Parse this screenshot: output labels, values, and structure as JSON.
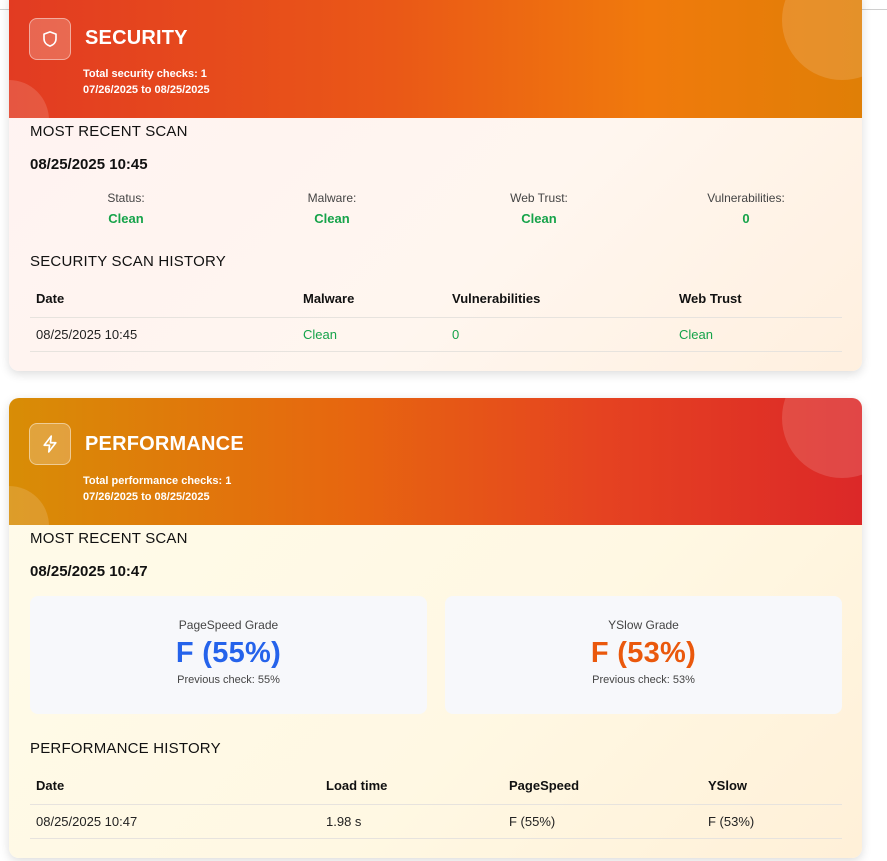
{
  "security": {
    "title": "SECURITY",
    "checks_text": "Total security checks: 1",
    "date_range": "07/26/2025 to 08/25/2025",
    "recent_heading": "MOST RECENT SCAN",
    "recent_time": "08/25/2025 10:45",
    "stats": [
      {
        "label": "Status:",
        "value": "Clean"
      },
      {
        "label": "Malware:",
        "value": "Clean"
      },
      {
        "label": "Web Trust:",
        "value": "Clean"
      },
      {
        "label": "Vulnerabilities:",
        "value": "0"
      }
    ],
    "history_heading": "SECURITY SCAN HISTORY",
    "history_columns": [
      "Date",
      "Malware",
      "Vulnerabilities",
      "Web Trust"
    ],
    "history_rows": [
      [
        "08/25/2025 10:45",
        "Clean",
        "0",
        "Clean"
      ]
    ]
  },
  "performance": {
    "title": "PERFORMANCE",
    "checks_text": "Total performance checks: 1",
    "date_range": "07/26/2025 to 08/25/2025",
    "recent_heading": "MOST RECENT SCAN",
    "recent_time": "08/25/2025 10:47",
    "pagespeed": {
      "label": "PageSpeed Grade",
      "value": "F (55%)",
      "previous": "Previous check: 55%",
      "color": "#2563eb"
    },
    "yslow": {
      "label": "YSlow Grade",
      "value": "F (53%)",
      "previous": "Previous check: 53%",
      "color": "#ea580c"
    },
    "history_heading": "PERFORMANCE HISTORY",
    "history_columns": [
      "Date",
      "Load time",
      "PageSpeed",
      "YSlow"
    ],
    "history_rows": [
      [
        "08/25/2025 10:47",
        "1.98 s",
        "F (55%)",
        "F (53%)"
      ]
    ]
  },
  "colors": {
    "clean": "#16a34a",
    "pagespeed": "#2563eb",
    "yslow": "#ea580c"
  },
  "icons": {
    "security": "shield-icon",
    "performance": "lightning-icon"
  }
}
